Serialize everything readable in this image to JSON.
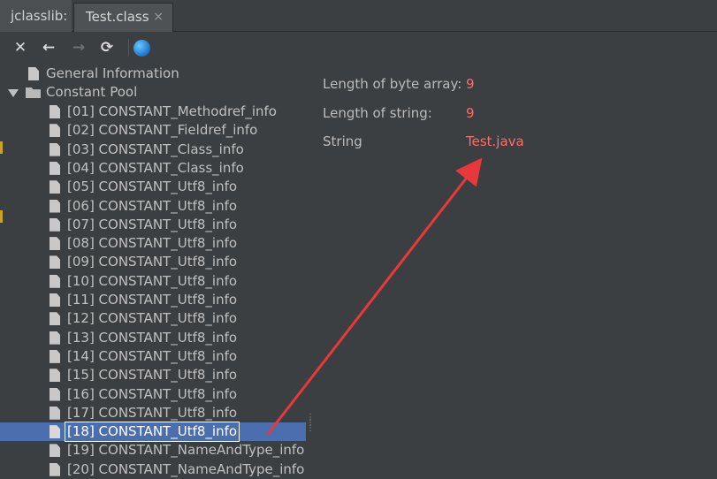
{
  "tabbar": {
    "tool_label": "jclasslib:",
    "active_tab": "Test.class",
    "close_symbol": "×"
  },
  "toolbar": {
    "buttons": [
      {
        "icon": "close-icon",
        "glyph": "✕"
      },
      {
        "icon": "back-arrow-icon",
        "glyph": "←"
      },
      {
        "icon": "forward-arrow-icon",
        "glyph": "→"
      },
      {
        "icon": "refresh-icon",
        "glyph": "⟳"
      },
      {
        "icon": "globe-icon",
        "glyph": ""
      }
    ]
  },
  "tree": {
    "general": "General Information",
    "constant_pool": "Constant Pool",
    "items": [
      "[01] CONSTANT_Methodref_info",
      "[02] CONSTANT_Fieldref_info",
      "[03] CONSTANT_Class_info",
      "[04] CONSTANT_Class_info",
      "[05] CONSTANT_Utf8_info",
      "[06] CONSTANT_Utf8_info",
      "[07] CONSTANT_Utf8_info",
      "[08] CONSTANT_Utf8_info",
      "[09] CONSTANT_Utf8_info",
      "[10] CONSTANT_Utf8_info",
      "[11] CONSTANT_Utf8_info",
      "[12] CONSTANT_Utf8_info",
      "[13] CONSTANT_Utf8_info",
      "[14] CONSTANT_Utf8_info",
      "[15] CONSTANT_Utf8_info",
      "[16] CONSTANT_Utf8_info",
      "[17] CONSTANT_Utf8_info",
      "[18] CONSTANT_Utf8_info",
      "[19] CONSTANT_NameAndType_info",
      "[20] CONSTANT_NameAndType_info"
    ],
    "selected_index": 17
  },
  "details": {
    "rows": [
      {
        "label": "Length of byte array:",
        "value": "9"
      },
      {
        "label": "Length of string:",
        "value": "9"
      },
      {
        "label": "String",
        "value": "Test.java"
      }
    ]
  },
  "colors": {
    "value_red": "#ff6b68",
    "selection_blue": "#4b6eaf",
    "annotation_arrow": "#e8383b"
  }
}
